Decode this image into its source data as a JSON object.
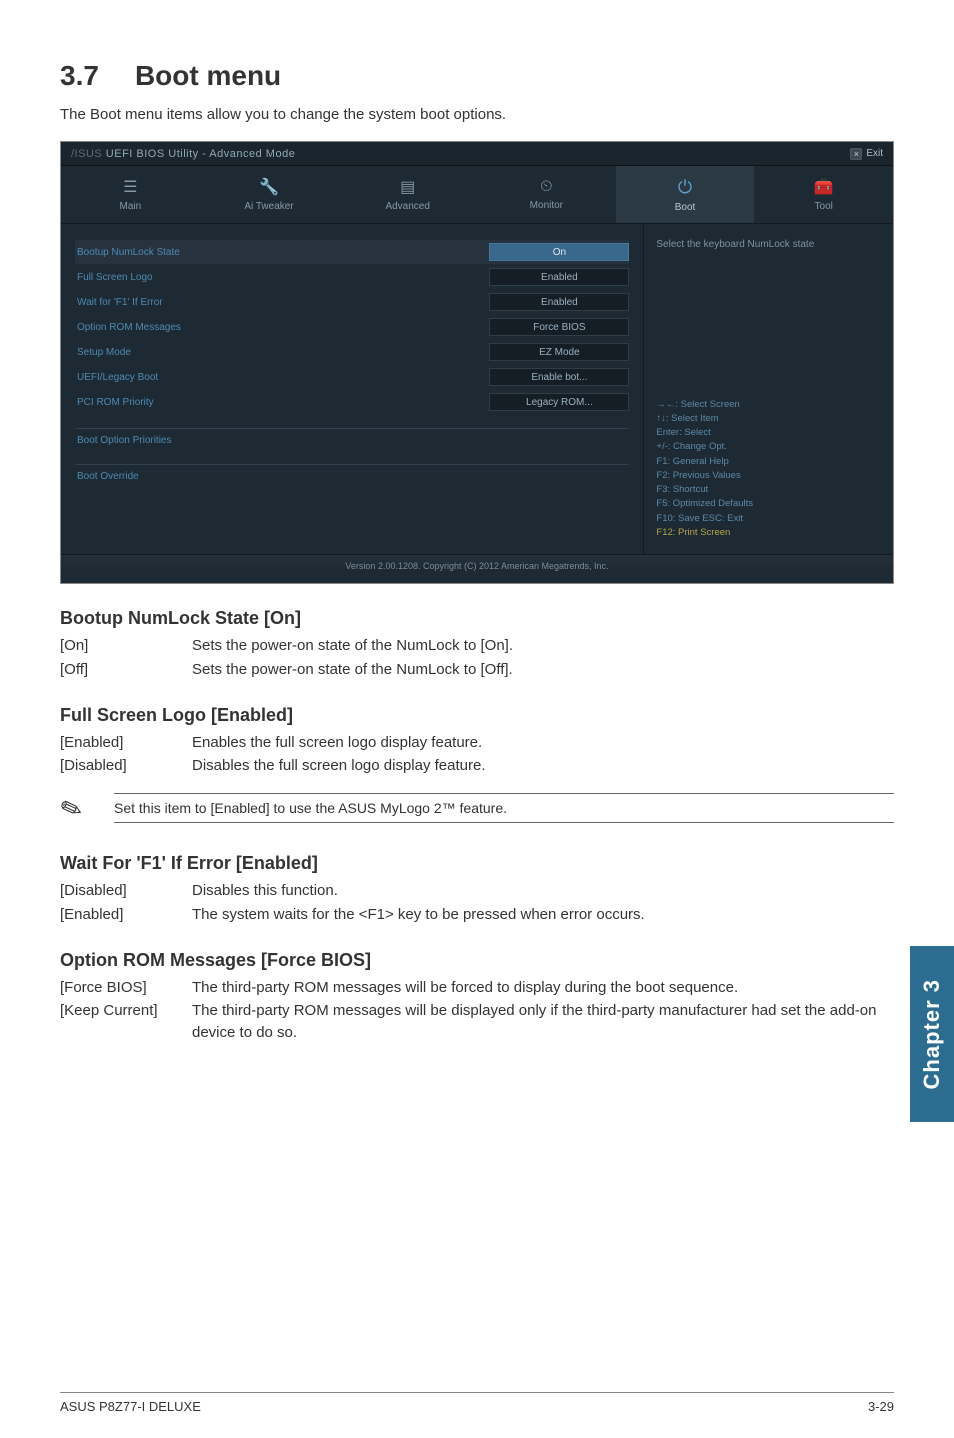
{
  "section_number": "3.7",
  "section_title": "Boot menu",
  "intro": "The Boot menu items allow you to change the system boot options.",
  "bios": {
    "title": "UEFI BIOS Utility - Advanced Mode",
    "exit": "Exit",
    "tabs": [
      {
        "label": "Main"
      },
      {
        "label": "Ai  Tweaker"
      },
      {
        "label": "Advanced"
      },
      {
        "label": "Monitor"
      },
      {
        "label": "Boot"
      },
      {
        "label": "Tool"
      }
    ],
    "rows": [
      {
        "label": "Bootup NumLock State",
        "value": "On",
        "selected": true
      },
      {
        "label": "Full Screen Logo",
        "value": "Enabled"
      },
      {
        "label": "Wait for 'F1' If Error",
        "value": "Enabled"
      },
      {
        "label": "Option ROM Messages",
        "value": "Force BIOS"
      },
      {
        "label": "Setup Mode",
        "value": "EZ Mode"
      },
      {
        "label": "UEFI/Legacy Boot",
        "value": "Enable bot..."
      },
      {
        "label": "PCI ROM Priority",
        "value": "Legacy ROM..."
      }
    ],
    "groups": [
      {
        "title": "Boot Option Priorities"
      },
      {
        "title": "Boot Override"
      }
    ],
    "help": "Select the keyboard NumLock state",
    "nav": {
      "l1": "→←: Select Screen",
      "l2": "↑↓: Select Item",
      "l3": "Enter: Select",
      "l4": "+/-: Change Opt.",
      "l5": "F1: General Help",
      "l6": "F2: Previous Values",
      "l7": "F3: Shortcut",
      "l8": "F5: Optimized Defaults",
      "l9": "F10: Save   ESC: Exit",
      "l10": "F12: Print Screen"
    },
    "footer": "Version 2.00.1208.  Copyright (C) 2012 American Megatrends, Inc."
  },
  "sub1": {
    "heading": "Bootup NumLock State [On]",
    "rows": [
      {
        "k": "[On]",
        "v": "Sets the power-on state of the NumLock to [On]."
      },
      {
        "k": "[Off]",
        "v": "Sets the power-on state of the NumLock to [Off]."
      }
    ]
  },
  "sub2": {
    "heading": "Full Screen Logo [Enabled]",
    "rows": [
      {
        "k": "[Enabled]",
        "v": "Enables the full screen logo display feature."
      },
      {
        "k": "[Disabled]",
        "v": "Disables the full screen logo display feature."
      }
    ],
    "note": "Set this item to [Enabled] to use the ASUS MyLogo 2™ feature."
  },
  "sub3": {
    "heading": "Wait For 'F1' If Error [Enabled]",
    "rows": [
      {
        "k": "[Disabled]",
        "v": "Disables this function."
      },
      {
        "k": "[Enabled]",
        "v": "The system waits for the <F1> key to be pressed when error occurs."
      }
    ]
  },
  "sub4": {
    "heading": "Option ROM Messages [Force BIOS]",
    "rows": [
      {
        "k": "[Force BIOS]",
        "v": "The third-party ROM messages will be forced to display during the boot sequence."
      },
      {
        "k": "[Keep Current]",
        "v": "The third-party ROM messages will be displayed only if the third-party manufacturer had set the add-on device to do so."
      }
    ]
  },
  "chapter_tab": "Chapter 3",
  "footer_left": "ASUS P8Z77-I DELUXE",
  "footer_right": "3-29"
}
